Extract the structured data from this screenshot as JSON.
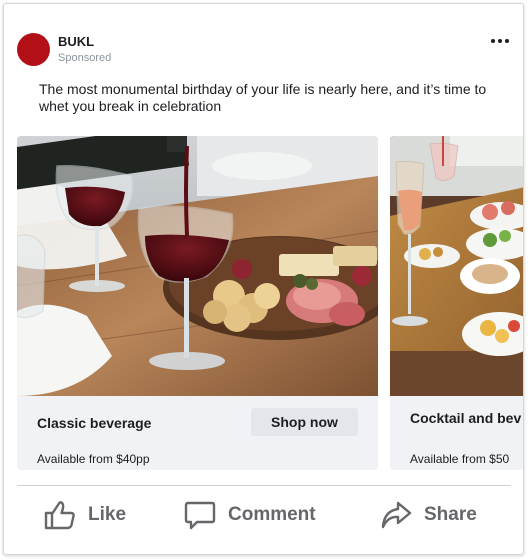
{
  "post": {
    "page_name": "BUKL",
    "sponsored_label": "Sponsored",
    "text": "The most monumental birthday of your life is nearly here, and it’s time to whet you break in celebration"
  },
  "carousel": {
    "cards": [
      {
        "title": "Classic beverage",
        "price": "Available from $40pp",
        "cta": "Shop now"
      },
      {
        "title": "Cocktail and bev",
        "price": "Available from $50"
      }
    ]
  },
  "actions": {
    "like": "Like",
    "comment": "Comment",
    "share": "Share"
  },
  "icons": {
    "more": "more-options-icon",
    "like": "thumbs-up-icon",
    "comment": "comment-bubble-icon",
    "share": "share-arrow-icon"
  },
  "colors": {
    "avatar": "#b30f16",
    "action_text": "#65676b",
    "button_bg": "#e4e6eb"
  }
}
